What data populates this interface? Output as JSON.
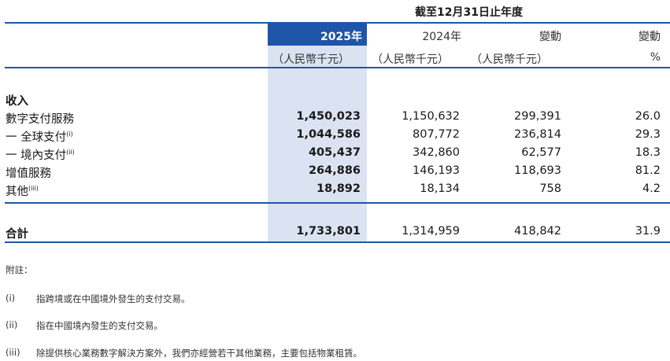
{
  "table": {
    "period_header": "截至12月31日止年度",
    "columns": [
      {
        "label": "2025年",
        "unit": "（人民幣千元）"
      },
      {
        "label": "2024年",
        "unit": "（人民幣千元）"
      },
      {
        "label": "變動",
        "unit": "（人民幣千元）"
      },
      {
        "label": "變動",
        "unit": "%"
      }
    ],
    "section_label": "收入",
    "rows": [
      {
        "label": "數字支付服務",
        "sup": "(i)",
        "values": [
          "1,450,023",
          "1,150,632",
          "299,391",
          "26.0"
        ]
      },
      {
        "label": "一 全球支付",
        "sup": "(i)",
        "values": [
          "1,044,586",
          "807,772",
          "236,814",
          "29.3"
        ]
      },
      {
        "label": "一 境內支付",
        "sup": "(ii)",
        "values": [
          "405,437",
          "342,860",
          "62,577",
          "18.3"
        ]
      },
      {
        "label": "增值服務",
        "sup": "",
        "values": [
          "264,886",
          "146,193",
          "118,693",
          "81.2"
        ]
      },
      {
        "label": "其他",
        "sup": "(iii)",
        "values": [
          "18,892",
          "18,134",
          "758",
          "4.2"
        ]
      }
    ],
    "total": {
      "label": "合計",
      "values": [
        "1,733,801",
        "1,314,959",
        "418,842",
        "31.9"
      ]
    }
  },
  "notes": {
    "title": "附註：",
    "items": [
      {
        "key": "(i)",
        "text": "指跨境或在中國境外發生的支付交易。"
      },
      {
        "key": "(ii)",
        "text": "指在中國境內發生的支付交易。"
      },
      {
        "key": "(iii)",
        "text": "除提供核心業務數字解決方案外，我們亦經營若干其他業務，主要包括物業租賃。"
      }
    ]
  },
  "colors": {
    "accent": "#1f55a8",
    "highlight": "#dbe3f2"
  }
}
